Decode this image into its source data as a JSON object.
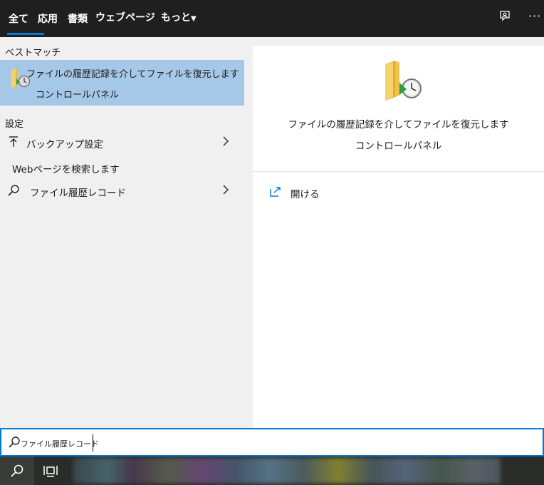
{
  "header": {
    "tabs": [
      {
        "label": "全て"
      },
      {
        "label": "応用"
      },
      {
        "label": "書類"
      },
      {
        "label": "ウェブページ"
      },
      {
        "label": "もっと"
      }
    ],
    "icons": [
      "feedback-icon",
      "more-options-icon"
    ]
  },
  "left": {
    "best_match_label": "ベストマッチ",
    "best_match": {
      "title": "ファイルの履歴記録を介してファイルを復元します",
      "subtitle": "コントロールパネル",
      "icon": "file-history-folder-icon"
    },
    "settings_label": "設定",
    "settings_items": [
      {
        "label": "バックアップ設定",
        "icon": "backup-arrow-icon"
      }
    ],
    "web_label": "Webページを検索します",
    "web_items": [
      {
        "label": "ファイル履歴レコード",
        "icon": "search-icon"
      }
    ]
  },
  "right": {
    "title": "ファイルの履歴記録を介してファイルを復元します",
    "subtitle": "コントロールパネル",
    "actions": [
      {
        "label": "開ける",
        "icon": "open-icon"
      }
    ]
  },
  "search": {
    "value": "ファイル履歴レコード"
  },
  "colors": {
    "accent": "#0078d7",
    "selected_bg": "#a6c8e8",
    "header_bg": "#1f1f1f",
    "taskbar_bg": "#2a2c2a"
  }
}
